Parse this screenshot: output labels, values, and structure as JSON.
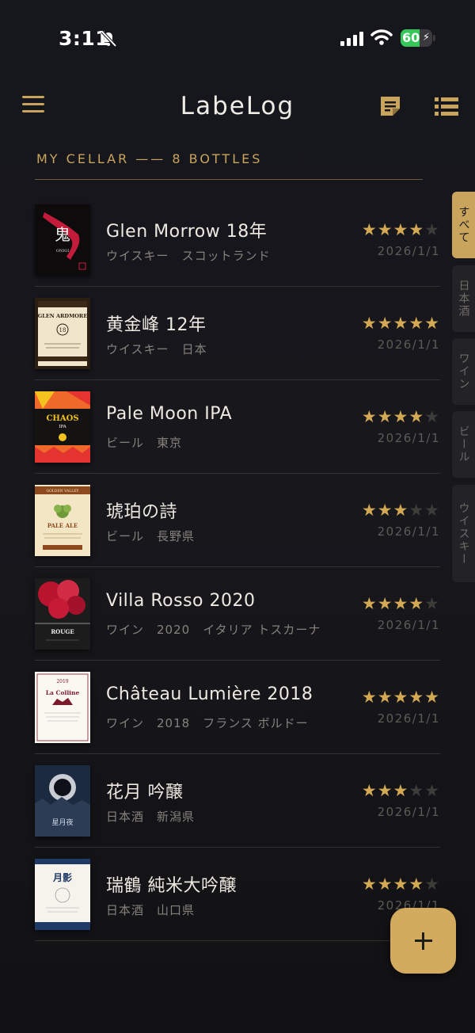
{
  "status_bar": {
    "time": "3:11",
    "battery": "60",
    "battery_level": 0.6
  },
  "header": {
    "title": "LabeLog",
    "subtitle": "MY CELLAR —— 8 BOTTLES"
  },
  "side_tabs": [
    {
      "label": "すべて",
      "active": true
    },
    {
      "label": "日本酒",
      "active": false
    },
    {
      "label": "ワイン",
      "active": false
    },
    {
      "label": "ビール",
      "active": false
    },
    {
      "label": "ウイスキー",
      "active": false
    }
  ],
  "items": [
    {
      "name": "Glen Morrow 18年",
      "category": "ウイスキー",
      "origin": "スコットランド",
      "rating": 4,
      "date": "2026/1/1",
      "label": {
        "main": "鬼",
        "sub": "ONIGI"
      }
    },
    {
      "name": "黄金峰 12年",
      "category": "ウイスキー",
      "origin": "日本",
      "rating": 5,
      "date": "2026/1/1",
      "label": {
        "main": "GLEN ARDMORE",
        "sub": "18"
      }
    },
    {
      "name": "Pale Moon IPA",
      "category": "ビール",
      "origin": "東京",
      "rating": 4,
      "date": "2026/1/1",
      "label": {
        "main": "CHAOS",
        "sub": "IPA"
      }
    },
    {
      "name": "琥珀の詩",
      "category": "ビール",
      "origin": "長野県",
      "rating": 3,
      "date": "2026/1/1",
      "label": {
        "main": "PALE ALE",
        "sub": "GOLDEN VALLEY"
      }
    },
    {
      "name": "Villa Rosso 2020",
      "category": "ワイン",
      "origin": "2020　イタリア トスカーナ",
      "rating": 4,
      "date": "2026/1/1",
      "label": {
        "main": "ROUGE",
        "sub": ""
      }
    },
    {
      "name": "Château Lumière 2018",
      "category": "ワイン",
      "origin": "2018　フランス ボルドー",
      "rating": 5,
      "date": "2026/1/1",
      "label": {
        "main": "La Colline",
        "sub": "2019"
      }
    },
    {
      "name": "花月 吟醸",
      "category": "日本酒",
      "origin": "新潟県",
      "rating": 3,
      "date": "2026/1/1",
      "label": {
        "main": "星月夜",
        "sub": ""
      }
    },
    {
      "name": "瑞鶴 純米大吟醸",
      "category": "日本酒",
      "origin": "山口県",
      "rating": 4,
      "date": "2026/1/1",
      "label": {
        "main": "月影",
        "sub": ""
      }
    }
  ],
  "colors": {
    "accent": "#c9a45c",
    "background": "#16161d",
    "star_on": "#d4a954",
    "star_off": "#3d3c39"
  },
  "icons": {
    "menu": "hamburger-icon",
    "notes": "notes-icon",
    "list": "list-view-icon",
    "add": "plus-icon"
  }
}
